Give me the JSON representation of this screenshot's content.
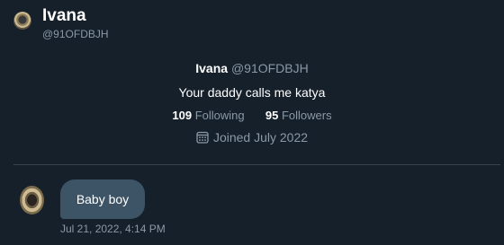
{
  "header": {
    "name": "Ivana",
    "handle": "@91OFDBJH"
  },
  "profile": {
    "name": "Ivana",
    "handle": "@91OFDBJH",
    "bio": "Your daddy calls me katya",
    "following_count": "109",
    "following_label": "Following",
    "followers_count": "95",
    "followers_label": "Followers",
    "joined": "Joined July 2022",
    "joined_icon": "calendar-icon"
  },
  "message": {
    "text": "Baby boy",
    "timestamp": "Jul 21, 2022, 4:14 PM"
  },
  "colors": {
    "background": "#15202b",
    "bubble": "#3d5466",
    "muted_text": "#8b98a5",
    "divider": "#38444d"
  }
}
